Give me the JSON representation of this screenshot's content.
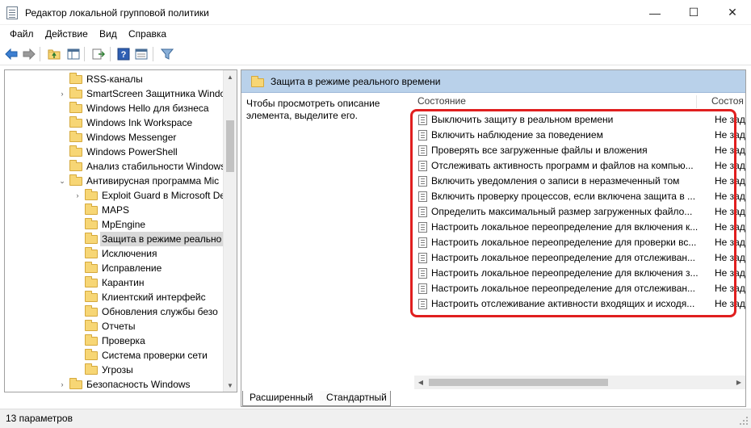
{
  "window": {
    "title": "Редактор локальной групповой политики",
    "minimize_glyph": "—",
    "maximize_glyph": "☐",
    "close_glyph": "✕"
  },
  "menu": [
    "Файл",
    "Действие",
    "Вид",
    "Справка"
  ],
  "toolbar": {
    "icons": [
      "back-arrow-icon",
      "forward-arrow-icon",
      "up-folder-icon",
      "show-hide-tree-icon",
      "export-list-icon",
      "help-icon",
      "properties-icon",
      "filter-icon"
    ]
  },
  "tree": {
    "items": [
      {
        "label": "RSS-каналы",
        "arrow": ""
      },
      {
        "label": "SmartScreen Защитника Windo",
        "arrow": "›"
      },
      {
        "label": "Windows Hello для бизнеса",
        "arrow": ""
      },
      {
        "label": "Windows Ink Workspace",
        "arrow": ""
      },
      {
        "label": "Windows Messenger",
        "arrow": ""
      },
      {
        "label": "Windows PowerShell",
        "arrow": ""
      },
      {
        "label": "Анализ стабильности Windows",
        "arrow": ""
      },
      {
        "label": "Антивирусная программа Mic",
        "arrow": "⌄"
      },
      {
        "label": "Exploit Guard в Microsoft De",
        "arrow": "›"
      },
      {
        "label": "MAPS",
        "arrow": ""
      },
      {
        "label": "MpEngine",
        "arrow": ""
      },
      {
        "label": "Защита в режиме реально",
        "arrow": "",
        "selected": true
      },
      {
        "label": "Исключения",
        "arrow": ""
      },
      {
        "label": "Исправление",
        "arrow": ""
      },
      {
        "label": "Карантин",
        "arrow": ""
      },
      {
        "label": "Клиентский интерфейс",
        "arrow": ""
      },
      {
        "label": "Обновления службы безо",
        "arrow": ""
      },
      {
        "label": "Отчеты",
        "arrow": ""
      },
      {
        "label": "Проверка",
        "arrow": ""
      },
      {
        "label": "Система проверки сети",
        "arrow": ""
      },
      {
        "label": "Угрозы",
        "arrow": ""
      },
      {
        "label": "Безопасность Windows",
        "arrow": "›"
      }
    ]
  },
  "details": {
    "header_title": "Защита в режиме реального времени",
    "description": "Чтобы просмотреть описание элемента, выделите его.",
    "columns": [
      "Состояние",
      "Состоя"
    ],
    "rows": [
      {
        "name": "Выключить защиту в реальном времени",
        "state": "Не зада"
      },
      {
        "name": "Включить наблюдение за поведением",
        "state": "Не зада"
      },
      {
        "name": "Проверять все загруженные файлы и вложения",
        "state": "Не зада"
      },
      {
        "name": "Отслеживать активность программ и файлов на компью...",
        "state": "Не зада"
      },
      {
        "name": "Включить уведомления о записи в неразмеченный том",
        "state": "Не зада"
      },
      {
        "name": "Включить проверку процессов, если включена защита в ...",
        "state": "Не зада"
      },
      {
        "name": "Определить максимальный размер загруженных файло...",
        "state": "Не зада"
      },
      {
        "name": "Настроить локальное переопределение для включения к...",
        "state": "Не зада"
      },
      {
        "name": "Настроить локальное переопределение для проверки вс...",
        "state": "Не зада"
      },
      {
        "name": "Настроить локальное переопределение для отслеживан...",
        "state": "Не зада"
      },
      {
        "name": "Настроить локальное переопределение для включения з...",
        "state": "Не зада"
      },
      {
        "name": "Настроить локальное переопределение для отслеживан...",
        "state": "Не зада"
      },
      {
        "name": "Настроить отслеживание активности входящих и исходя...",
        "state": "Не зада"
      }
    ]
  },
  "tabs": [
    "Расширенный",
    "Стандартный"
  ],
  "status": "13 параметров",
  "colors": {
    "header_bg": "#b9d1ea",
    "highlight_border": "#e01f1f",
    "folder": "#f7d675"
  }
}
